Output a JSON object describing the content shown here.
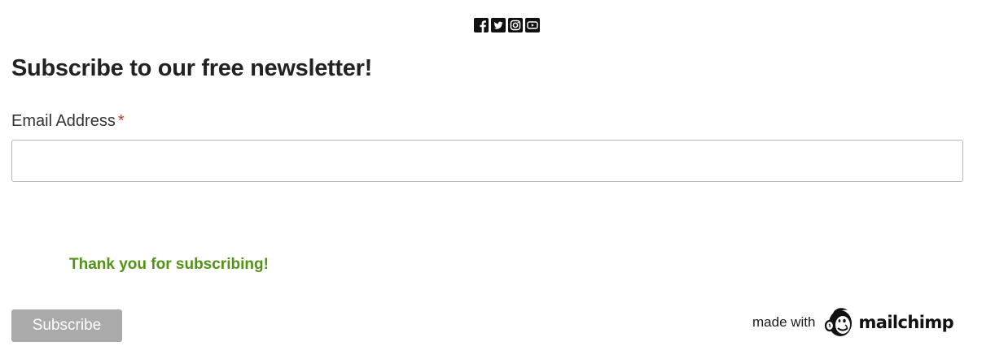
{
  "social": {
    "icons": [
      "facebook-icon",
      "twitter-icon",
      "instagram-icon",
      "youtube-icon"
    ]
  },
  "newsletter": {
    "heading": "Subscribe to our free newsletter!",
    "email_label": "Email Address",
    "required_marker": "*",
    "email_value": "",
    "success_message": "Thank you for subscribing!",
    "subscribe_label": "Subscribe"
  },
  "badge": {
    "made_with": "made with",
    "brand": "mailchimp"
  },
  "colors": {
    "heading": "#222222",
    "required": "#c0392b",
    "success": "#529214",
    "button_bg": "#aaaaaa",
    "button_text": "#ffffff",
    "input_border": "#b9b9b9"
  }
}
